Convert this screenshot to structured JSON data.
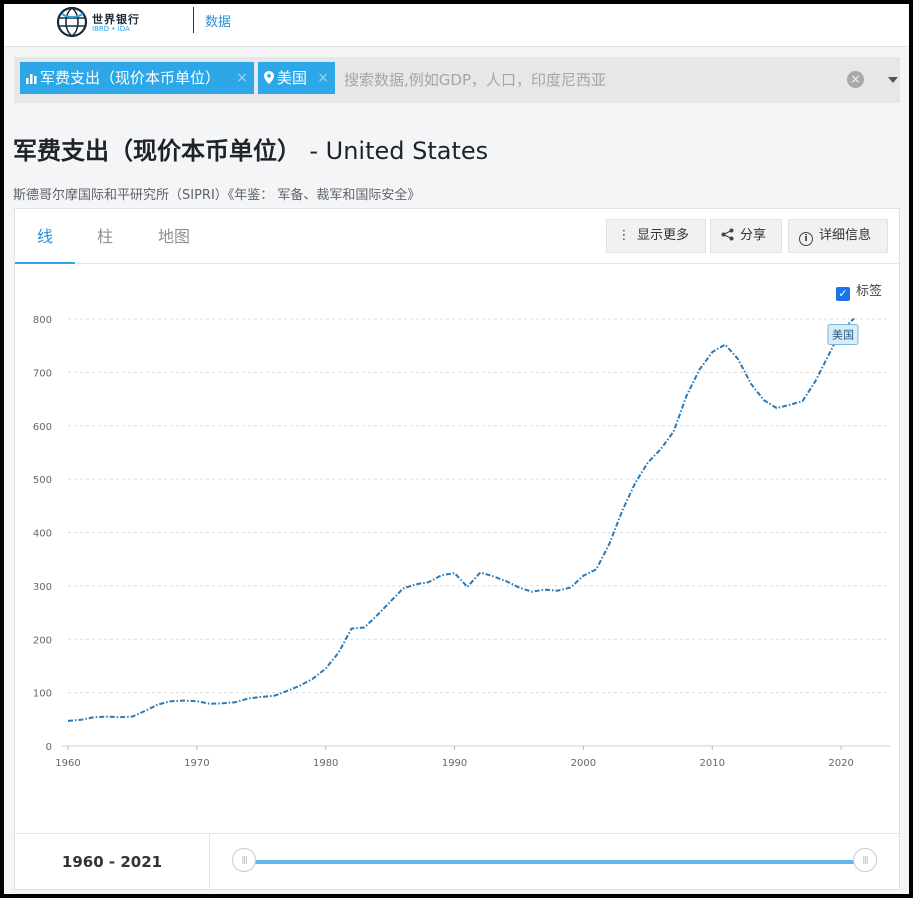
{
  "header": {
    "brand_cn": "世界银行",
    "brand_en": "IBRD • IDA",
    "nav_data": "数据"
  },
  "search": {
    "chips": [
      {
        "label": "军费支出（现价本币单位）",
        "icon": "bar-chart-icon"
      },
      {
        "label": "美国",
        "icon": "location-pin-icon"
      }
    ],
    "chip_close": "×",
    "placeholder": "搜索数据,例如GDP，人口，印度尼西亚",
    "clear": "×"
  },
  "page": {
    "title": "军费支出（现价本币单位）",
    "title_country": "- United States",
    "source": "斯德哥尔摩国际和平研究所（SIPRI）《年鉴： 军备、裁军和国际安全》"
  },
  "tabs": [
    {
      "label": "线",
      "active": true
    },
    {
      "label": "柱",
      "active": false
    },
    {
      "label": "地图",
      "active": false
    }
  ],
  "toolbar": {
    "more": "显示更多",
    "share": "分享",
    "info": "详细信息"
  },
  "labels_toggle": {
    "label": "标签",
    "checked": true
  },
  "range": {
    "start": "1960",
    "sep": " - ",
    "end": "2021"
  },
  "colors": {
    "line": "#2a7ab8",
    "accent": "#2ea7e8",
    "chip": "#2ea7e8"
  },
  "chart_data": {
    "type": "line",
    "title": "",
    "xlabel": "",
    "ylabel": "",
    "xlim": [
      1960,
      2022
    ],
    "ylim": [
      0,
      800
    ],
    "yticks": [
      0,
      100,
      200,
      300,
      400,
      500,
      600,
      700,
      800
    ],
    "xticks": [
      1960,
      1970,
      1980,
      1990,
      2000,
      2010,
      2020
    ],
    "grid": true,
    "line_style": "dash-dot",
    "series": [
      {
        "name": "美国",
        "x": [
          1960,
          1961,
          1962,
          1963,
          1964,
          1965,
          1966,
          1967,
          1968,
          1969,
          1970,
          1971,
          1972,
          1973,
          1974,
          1975,
          1976,
          1977,
          1978,
          1979,
          1980,
          1981,
          1982,
          1983,
          1984,
          1985,
          1986,
          1987,
          1988,
          1989,
          1990,
          1991,
          1992,
          1993,
          1994,
          1995,
          1996,
          1997,
          1998,
          1999,
          2000,
          2001,
          2002,
          2003,
          2004,
          2005,
          2006,
          2007,
          2008,
          2009,
          2010,
          2011,
          2012,
          2013,
          2014,
          2015,
          2016,
          2017,
          2018,
          2019,
          2020,
          2021
        ],
        "values": [
          47,
          49,
          54,
          55,
          54,
          55,
          66,
          78,
          84,
          85,
          84,
          79,
          80,
          82,
          89,
          92,
          94,
          103,
          113,
          126,
          145,
          175,
          220,
          222,
          245,
          270,
          295,
          303,
          307,
          320,
          324,
          298,
          325,
          318,
          309,
          297,
          289,
          293,
          291,
          297,
          319,
          331,
          378,
          440,
          492,
          531,
          556,
          589,
          656,
          705,
          738,
          752,
          725,
          679,
          648,
          633,
          639,
          646,
          683,
          731,
          778,
          801
        ]
      }
    ]
  }
}
